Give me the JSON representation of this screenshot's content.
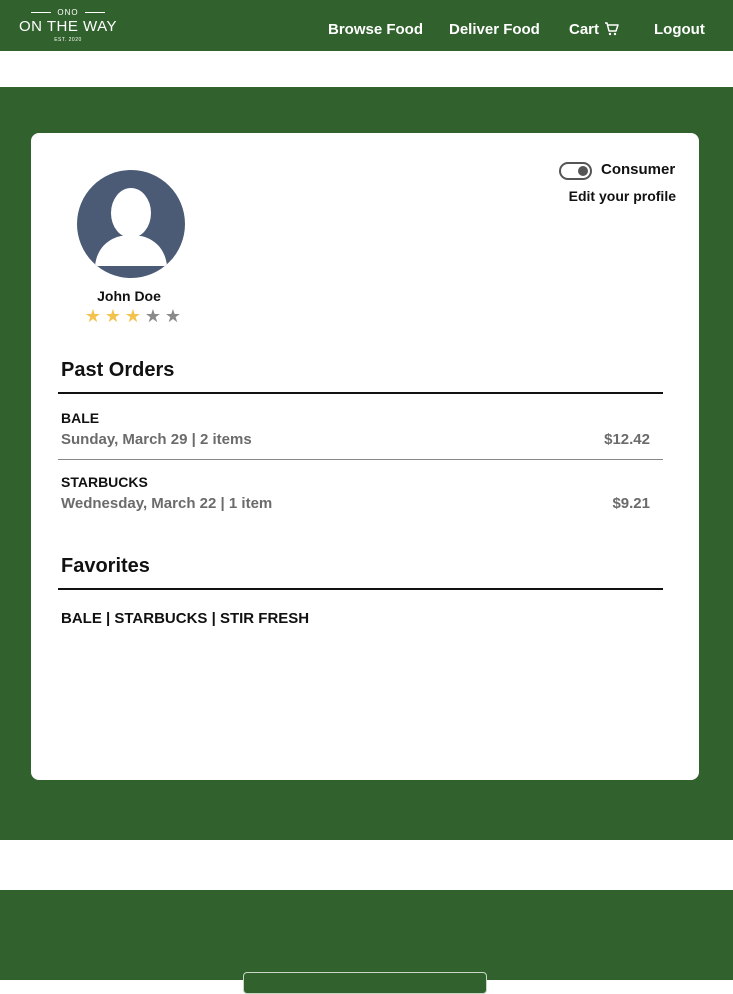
{
  "header": {
    "logo": {
      "top": "ONO",
      "name": "ON THE WAY",
      "est": "EST. 2020"
    },
    "nav": {
      "browse": "Browse Food",
      "deliver": "Deliver Food",
      "cart": "Cart",
      "logout": "Logout"
    }
  },
  "profile": {
    "name": "John Doe",
    "rating": 3,
    "rating_max": 5,
    "role_label": "Consumer",
    "edit_label": "Edit your profile"
  },
  "past_orders": {
    "title": "Past Orders",
    "orders": [
      {
        "restaurant": "BALE",
        "date": "Sunday, March 29",
        "items": "2 items",
        "price": "$12.42"
      },
      {
        "restaurant": "STARBUCKS",
        "date": "Wednesday, March 22",
        "items": "1 item",
        "price": "$9.21"
      }
    ]
  },
  "favorites": {
    "title": "Favorites",
    "list": "BALE | STARBUCKS | STIR FRESH"
  },
  "colors": {
    "brand_green": "#31622d",
    "star_filled": "#f2c34e",
    "star_empty": "#8a8a8a",
    "avatar_bg": "#4b5b76"
  }
}
